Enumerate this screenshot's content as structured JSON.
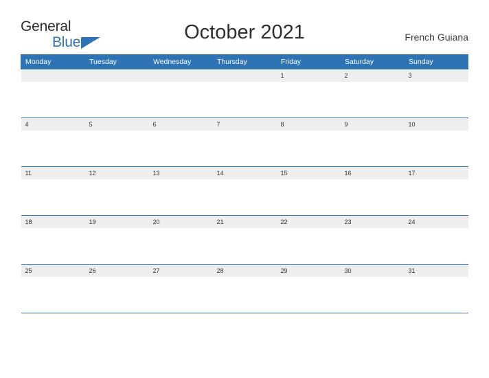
{
  "header": {
    "logo_top": "General",
    "logo_bottom": "Blue",
    "title": "October 2021",
    "country": "French Guiana"
  },
  "calendar": {
    "weekday_headers": [
      "Monday",
      "Tuesday",
      "Wednesday",
      "Thursday",
      "Friday",
      "Saturday",
      "Sunday"
    ],
    "weeks": [
      [
        "",
        "",
        "",
        "",
        "1",
        "2",
        "3"
      ],
      [
        "4",
        "5",
        "6",
        "7",
        "8",
        "9",
        "10"
      ],
      [
        "11",
        "12",
        "13",
        "14",
        "15",
        "16",
        "17"
      ],
      [
        "18",
        "19",
        "20",
        "21",
        "22",
        "23",
        "24"
      ],
      [
        "25",
        "26",
        "27",
        "28",
        "29",
        "30",
        "31"
      ]
    ]
  },
  "colors": {
    "accent": "#2e74b5",
    "daycell_bg": "#eeeeee",
    "text": "#2e2e2e"
  }
}
